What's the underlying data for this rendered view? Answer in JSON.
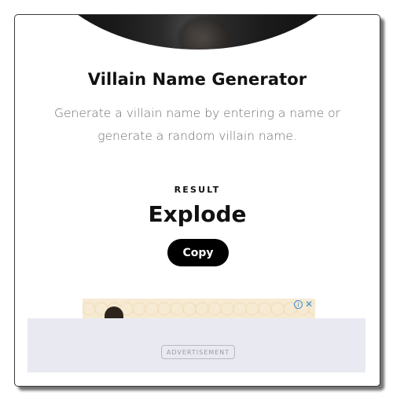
{
  "generator": {
    "title": "Villain Name Generator",
    "description": "Generate a villain name by entering a name or generate a random villain name."
  },
  "result": {
    "label": "RESULT",
    "value": "Explode",
    "copy_label": "Copy"
  },
  "ad": {
    "info_glyph": "i",
    "close_glyph": "✕",
    "tag_label": "ADVERTISEMENT"
  },
  "colors": {
    "button_bg": "#000000",
    "ad_slot_bg": "#e9eaf1",
    "ad_icon": "#3a8fd6"
  }
}
